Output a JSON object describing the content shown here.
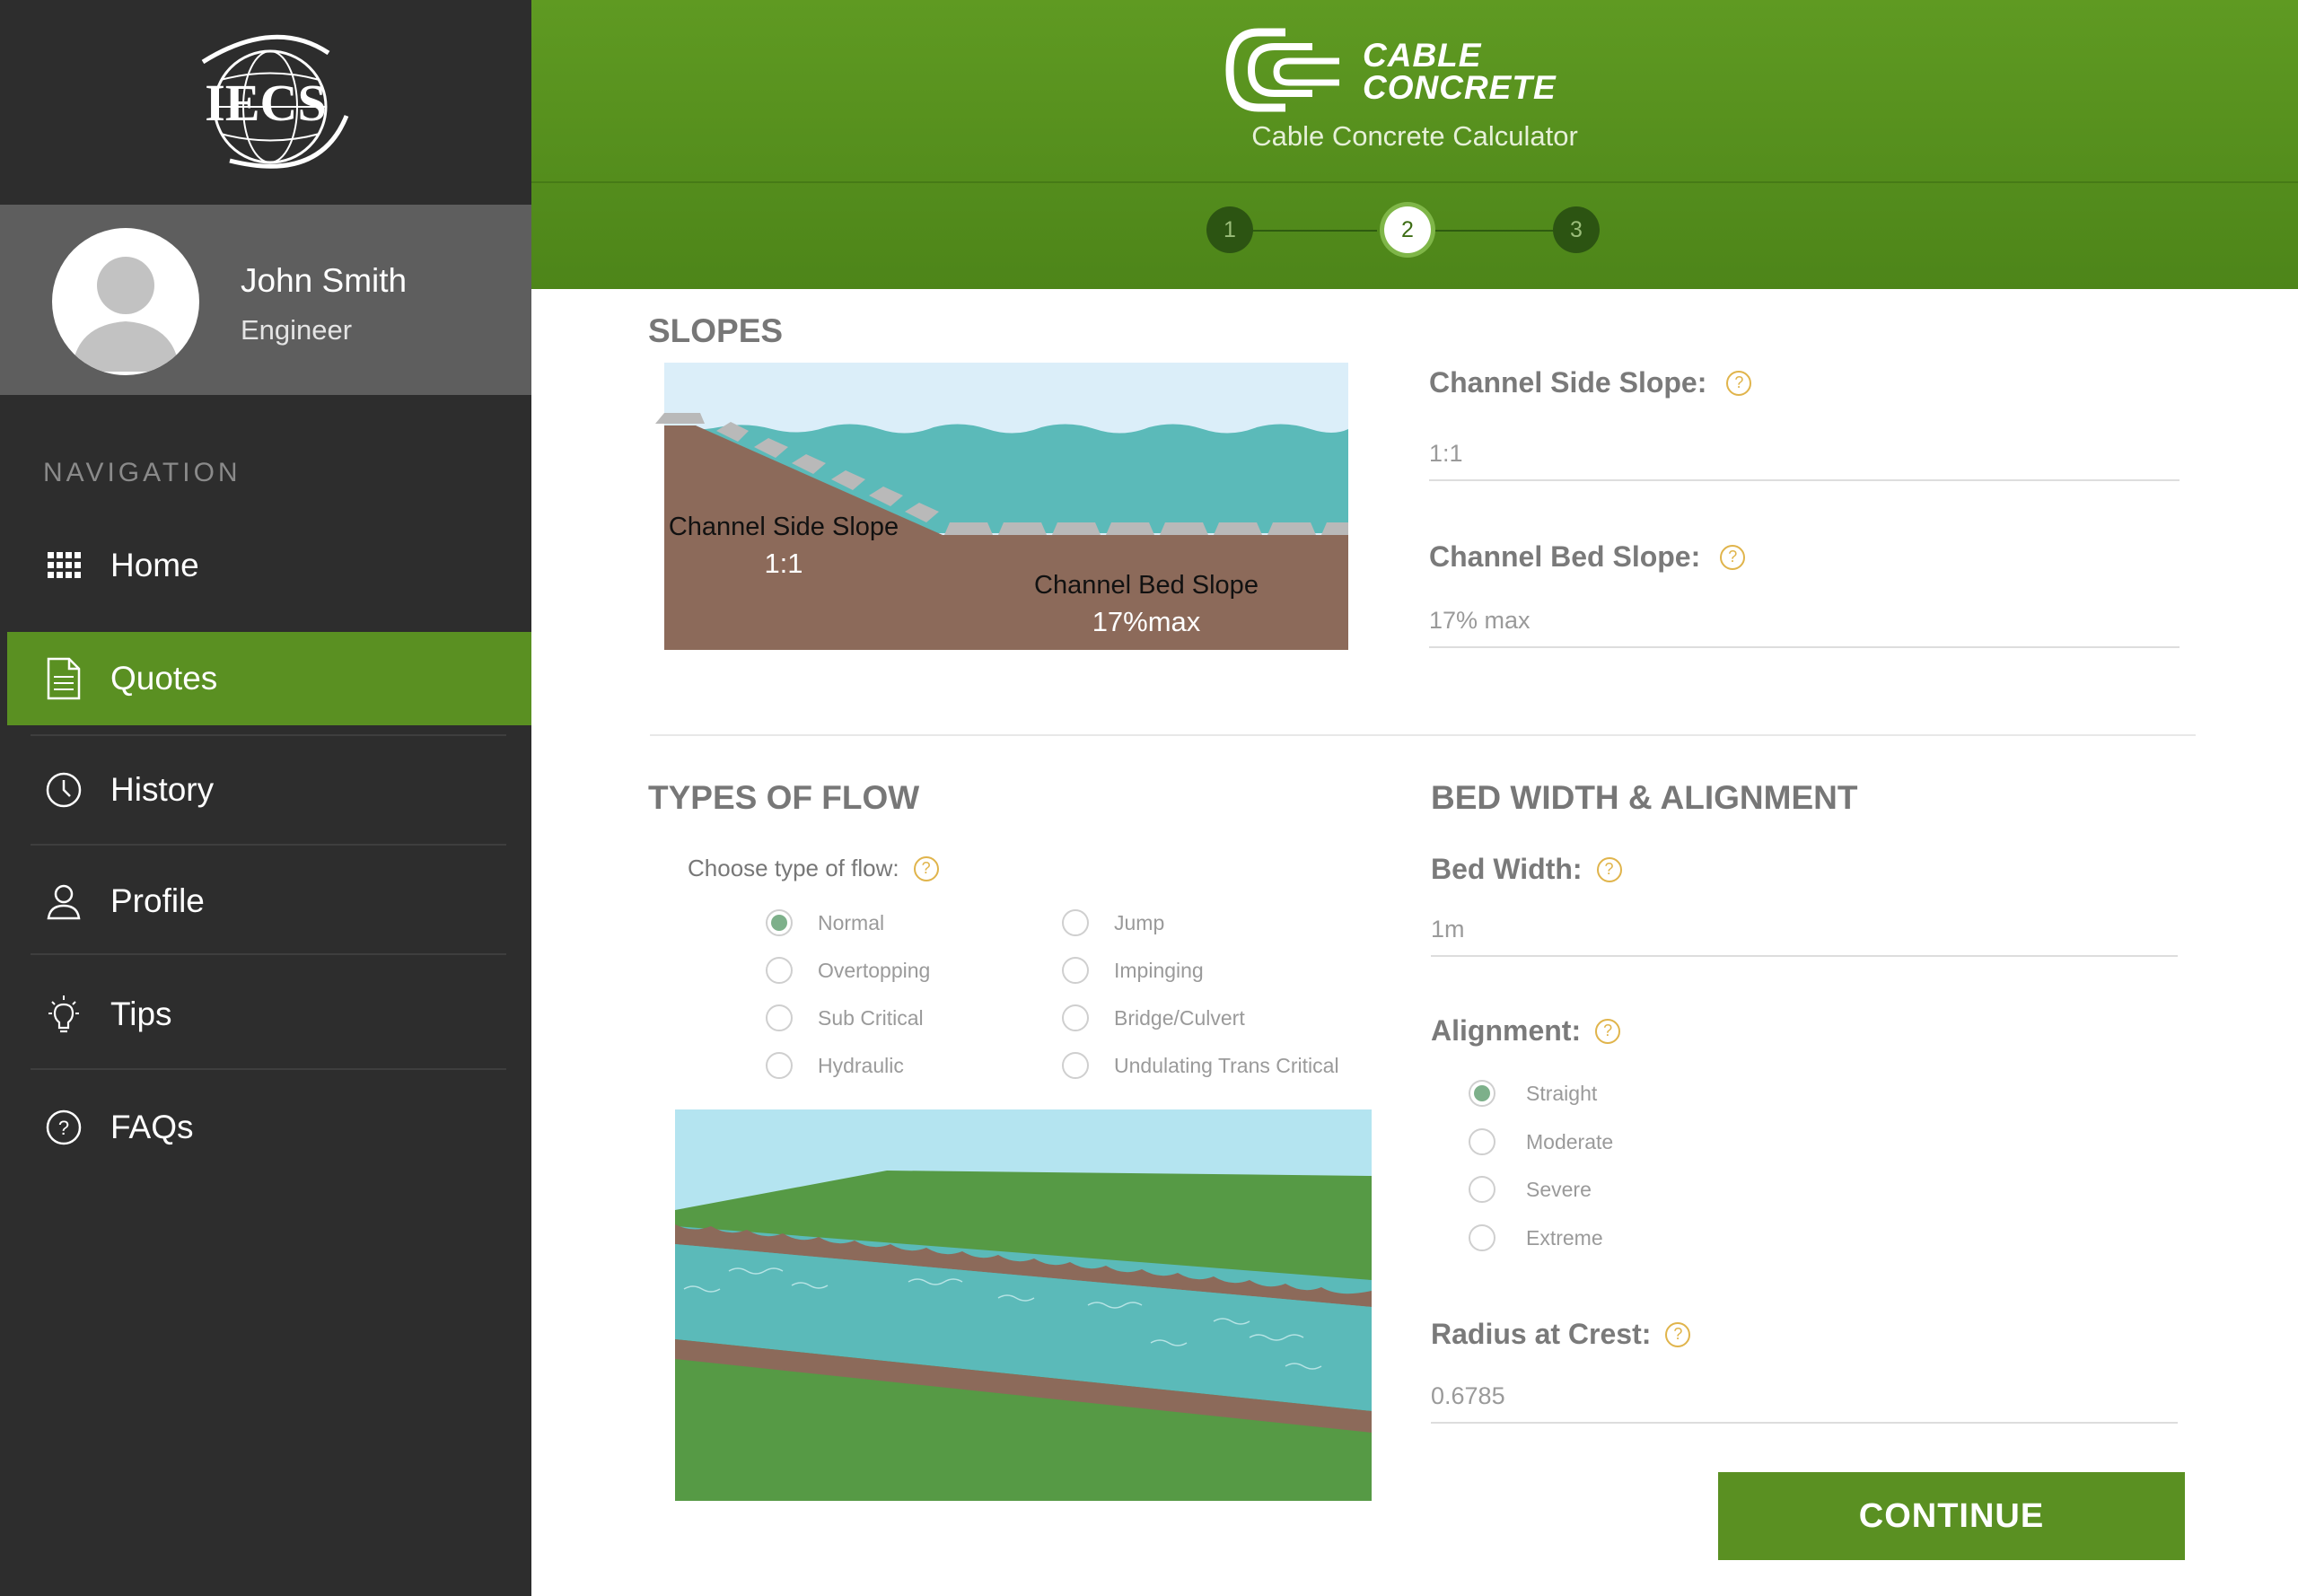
{
  "sidebar": {
    "logo_text": "IECS",
    "user": {
      "name": "John Smith",
      "role": "Engineer"
    },
    "nav_heading": "NAVIGATION",
    "items": [
      {
        "label": "Home",
        "icon": "grid-icon",
        "active": false
      },
      {
        "label": "Quotes",
        "icon": "document-icon",
        "active": true
      },
      {
        "label": "History",
        "icon": "clock-icon",
        "active": false
      },
      {
        "label": "Profile",
        "icon": "user-icon",
        "active": false
      },
      {
        "label": "Tips",
        "icon": "lightbulb-icon",
        "active": false
      },
      {
        "label": "FAQs",
        "icon": "question-icon",
        "active": false
      }
    ]
  },
  "header": {
    "brand_line1": "CABLE",
    "brand_line2": "CONCRETE",
    "subtitle": "Cable Concrete Calculator",
    "steps": [
      "1",
      "2",
      "3"
    ],
    "current_step": 2
  },
  "slopes": {
    "title": "SLOPES",
    "diagram": {
      "side_label": "Channel Side Slope",
      "side_value": "1:1",
      "bed_label": "Channel Bed Slope",
      "bed_value": "17%max"
    },
    "side_slope": {
      "label": "Channel Side Slope:",
      "value": "1:1"
    },
    "bed_slope": {
      "label": "Channel Bed Slope:",
      "value": "17% max"
    }
  },
  "flow": {
    "title": "TYPES OF FLOW",
    "choose_label": "Choose type of flow:",
    "options": [
      {
        "label": "Normal",
        "selected": true
      },
      {
        "label": "Jump",
        "selected": false
      },
      {
        "label": "Overtopping",
        "selected": false
      },
      {
        "label": "Impinging",
        "selected": false
      },
      {
        "label": "Sub Critical",
        "selected": false
      },
      {
        "label": "Bridge/Culvert",
        "selected": false
      },
      {
        "label": "Hydraulic",
        "selected": false
      },
      {
        "label": "Undulating Trans Critical",
        "selected": false
      }
    ]
  },
  "bed": {
    "title": "BED WIDTH & ALIGNMENT",
    "width": {
      "label": "Bed Width:",
      "value": "1m"
    },
    "alignment": {
      "label": "Alignment:",
      "options": [
        {
          "label": "Straight",
          "selected": true
        },
        {
          "label": "Moderate",
          "selected": false
        },
        {
          "label": "Severe",
          "selected": false
        },
        {
          "label": "Extreme",
          "selected": false
        }
      ]
    },
    "radius": {
      "label": "Radius at Crest:",
      "value": "0.6785"
    }
  },
  "continue_label": "CONTINUE",
  "colors": {
    "sidebar_bg": "#2d2d2d",
    "accent_green": "#5a9022",
    "help_yellow": "#e0b44b",
    "water": "#5bbab9",
    "soil": "#8c6a5a"
  }
}
